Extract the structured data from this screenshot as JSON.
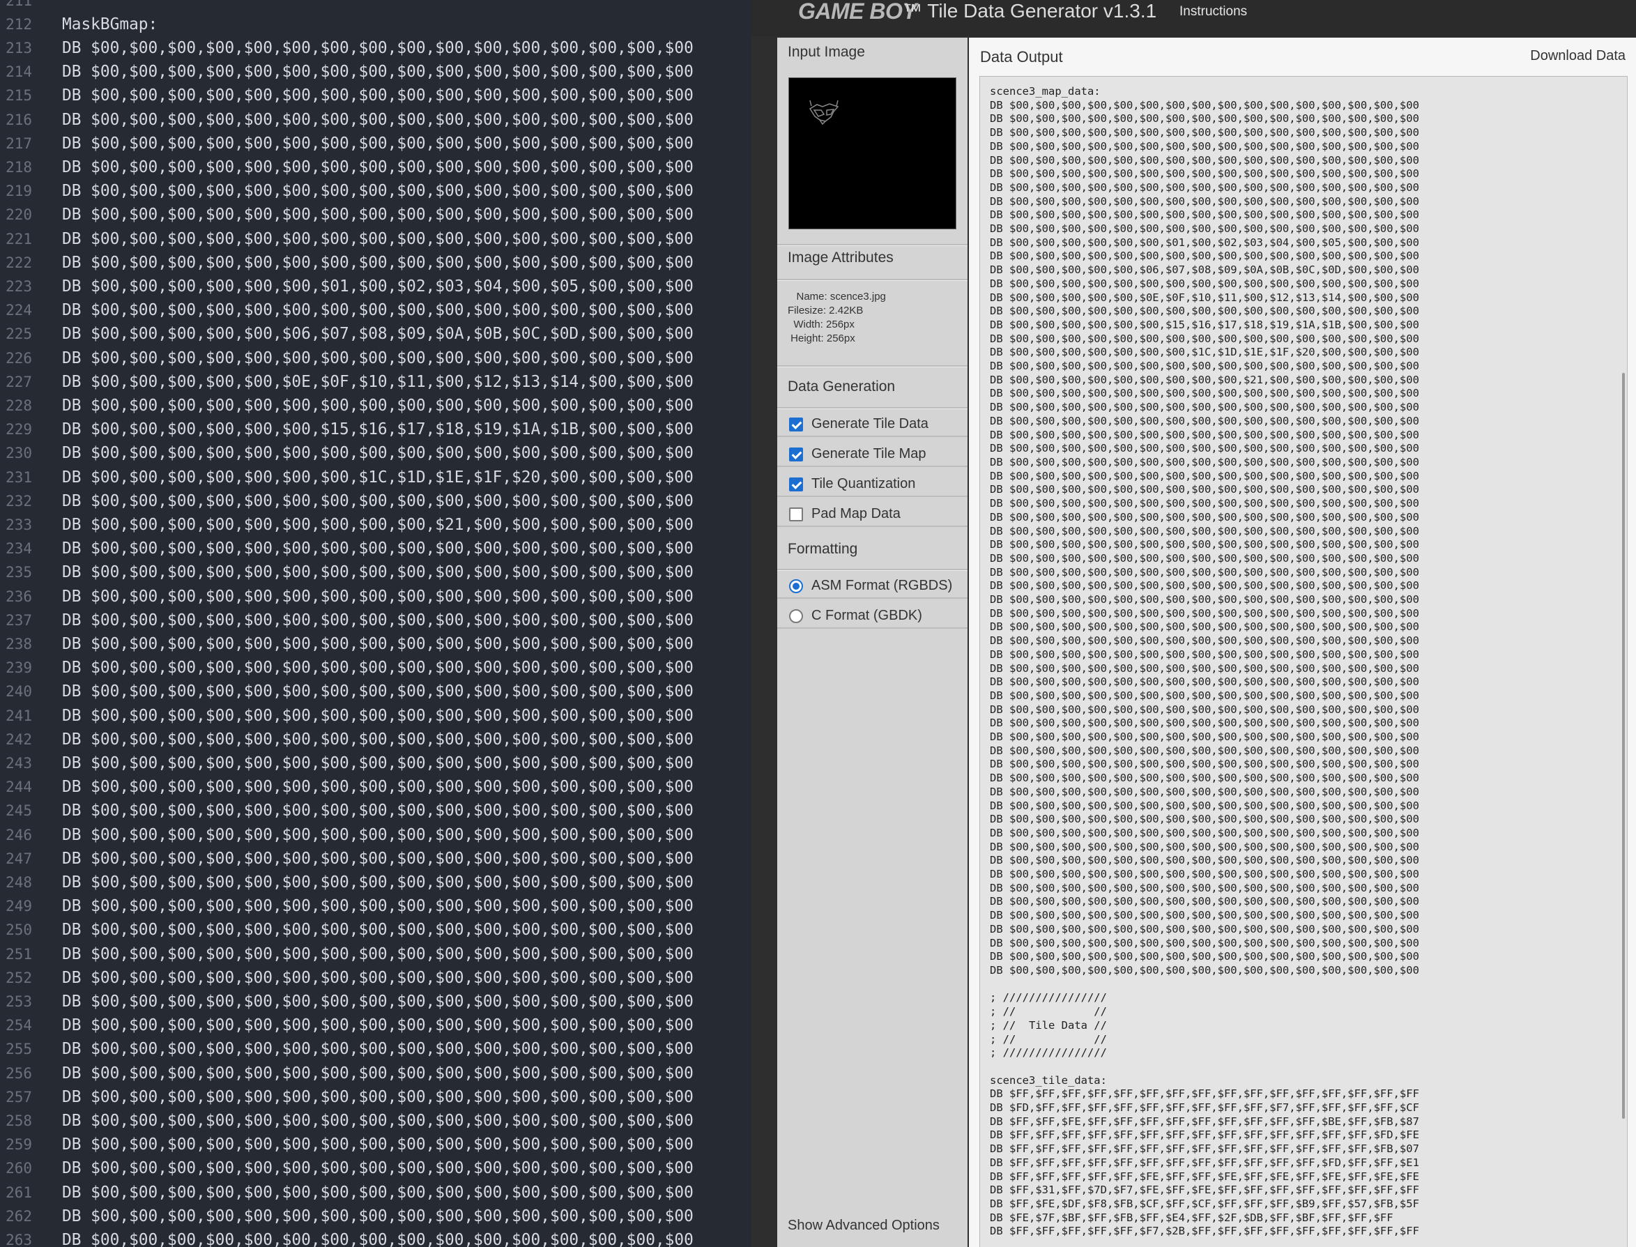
{
  "editor": {
    "lines": [
      {
        "n": "211",
        "t": ""
      },
      {
        "n": "212",
        "t": "MaskBGmap:"
      },
      {
        "n": "213",
        "t": "DB $00,$00,$00,$00,$00,$00,$00,$00,$00,$00,$00,$00,$00,$00,$00,$00"
      },
      {
        "n": "214",
        "t": "DB $00,$00,$00,$00,$00,$00,$00,$00,$00,$00,$00,$00,$00,$00,$00,$00"
      },
      {
        "n": "215",
        "t": "DB $00,$00,$00,$00,$00,$00,$00,$00,$00,$00,$00,$00,$00,$00,$00,$00"
      },
      {
        "n": "216",
        "t": "DB $00,$00,$00,$00,$00,$00,$00,$00,$00,$00,$00,$00,$00,$00,$00,$00"
      },
      {
        "n": "217",
        "t": "DB $00,$00,$00,$00,$00,$00,$00,$00,$00,$00,$00,$00,$00,$00,$00,$00"
      },
      {
        "n": "218",
        "t": "DB $00,$00,$00,$00,$00,$00,$00,$00,$00,$00,$00,$00,$00,$00,$00,$00"
      },
      {
        "n": "219",
        "t": "DB $00,$00,$00,$00,$00,$00,$00,$00,$00,$00,$00,$00,$00,$00,$00,$00"
      },
      {
        "n": "220",
        "t": "DB $00,$00,$00,$00,$00,$00,$00,$00,$00,$00,$00,$00,$00,$00,$00,$00"
      },
      {
        "n": "221",
        "t": "DB $00,$00,$00,$00,$00,$00,$00,$00,$00,$00,$00,$00,$00,$00,$00,$00"
      },
      {
        "n": "222",
        "t": "DB $00,$00,$00,$00,$00,$00,$00,$00,$00,$00,$00,$00,$00,$00,$00,$00"
      },
      {
        "n": "223",
        "t": "DB $00,$00,$00,$00,$00,$00,$01,$00,$02,$03,$04,$00,$05,$00,$00,$00"
      },
      {
        "n": "224",
        "t": "DB $00,$00,$00,$00,$00,$00,$00,$00,$00,$00,$00,$00,$00,$00,$00,$00"
      },
      {
        "n": "225",
        "t": "DB $00,$00,$00,$00,$00,$06,$07,$08,$09,$0A,$0B,$0C,$0D,$00,$00,$00"
      },
      {
        "n": "226",
        "t": "DB $00,$00,$00,$00,$00,$00,$00,$00,$00,$00,$00,$00,$00,$00,$00,$00"
      },
      {
        "n": "227",
        "t": "DB $00,$00,$00,$00,$00,$0E,$0F,$10,$11,$00,$12,$13,$14,$00,$00,$00"
      },
      {
        "n": "228",
        "t": "DB $00,$00,$00,$00,$00,$00,$00,$00,$00,$00,$00,$00,$00,$00,$00,$00"
      },
      {
        "n": "229",
        "t": "DB $00,$00,$00,$00,$00,$00,$15,$16,$17,$18,$19,$1A,$1B,$00,$00,$00"
      },
      {
        "n": "230",
        "t": "DB $00,$00,$00,$00,$00,$00,$00,$00,$00,$00,$00,$00,$00,$00,$00,$00"
      },
      {
        "n": "231",
        "t": "DB $00,$00,$00,$00,$00,$00,$00,$1C,$1D,$1E,$1F,$20,$00,$00,$00,$00"
      },
      {
        "n": "232",
        "t": "DB $00,$00,$00,$00,$00,$00,$00,$00,$00,$00,$00,$00,$00,$00,$00,$00"
      },
      {
        "n": "233",
        "t": "DB $00,$00,$00,$00,$00,$00,$00,$00,$00,$21,$00,$00,$00,$00,$00,$00"
      },
      {
        "n": "234",
        "t": "DB $00,$00,$00,$00,$00,$00,$00,$00,$00,$00,$00,$00,$00,$00,$00,$00"
      },
      {
        "n": "235",
        "t": "DB $00,$00,$00,$00,$00,$00,$00,$00,$00,$00,$00,$00,$00,$00,$00,$00"
      },
      {
        "n": "236",
        "t": "DB $00,$00,$00,$00,$00,$00,$00,$00,$00,$00,$00,$00,$00,$00,$00,$00"
      },
      {
        "n": "237",
        "t": "DB $00,$00,$00,$00,$00,$00,$00,$00,$00,$00,$00,$00,$00,$00,$00,$00"
      },
      {
        "n": "238",
        "t": "DB $00,$00,$00,$00,$00,$00,$00,$00,$00,$00,$00,$00,$00,$00,$00,$00"
      },
      {
        "n": "239",
        "t": "DB $00,$00,$00,$00,$00,$00,$00,$00,$00,$00,$00,$00,$00,$00,$00,$00"
      },
      {
        "n": "240",
        "t": "DB $00,$00,$00,$00,$00,$00,$00,$00,$00,$00,$00,$00,$00,$00,$00,$00"
      },
      {
        "n": "241",
        "t": "DB $00,$00,$00,$00,$00,$00,$00,$00,$00,$00,$00,$00,$00,$00,$00,$00"
      },
      {
        "n": "242",
        "t": "DB $00,$00,$00,$00,$00,$00,$00,$00,$00,$00,$00,$00,$00,$00,$00,$00"
      },
      {
        "n": "243",
        "t": "DB $00,$00,$00,$00,$00,$00,$00,$00,$00,$00,$00,$00,$00,$00,$00,$00"
      },
      {
        "n": "244",
        "t": "DB $00,$00,$00,$00,$00,$00,$00,$00,$00,$00,$00,$00,$00,$00,$00,$00"
      },
      {
        "n": "245",
        "t": "DB $00,$00,$00,$00,$00,$00,$00,$00,$00,$00,$00,$00,$00,$00,$00,$00"
      },
      {
        "n": "246",
        "t": "DB $00,$00,$00,$00,$00,$00,$00,$00,$00,$00,$00,$00,$00,$00,$00,$00"
      },
      {
        "n": "247",
        "t": "DB $00,$00,$00,$00,$00,$00,$00,$00,$00,$00,$00,$00,$00,$00,$00,$00"
      },
      {
        "n": "248",
        "t": "DB $00,$00,$00,$00,$00,$00,$00,$00,$00,$00,$00,$00,$00,$00,$00,$00"
      },
      {
        "n": "249",
        "t": "DB $00,$00,$00,$00,$00,$00,$00,$00,$00,$00,$00,$00,$00,$00,$00,$00"
      },
      {
        "n": "250",
        "t": "DB $00,$00,$00,$00,$00,$00,$00,$00,$00,$00,$00,$00,$00,$00,$00,$00"
      },
      {
        "n": "251",
        "t": "DB $00,$00,$00,$00,$00,$00,$00,$00,$00,$00,$00,$00,$00,$00,$00,$00"
      },
      {
        "n": "252",
        "t": "DB $00,$00,$00,$00,$00,$00,$00,$00,$00,$00,$00,$00,$00,$00,$00,$00"
      },
      {
        "n": "253",
        "t": "DB $00,$00,$00,$00,$00,$00,$00,$00,$00,$00,$00,$00,$00,$00,$00,$00"
      },
      {
        "n": "254",
        "t": "DB $00,$00,$00,$00,$00,$00,$00,$00,$00,$00,$00,$00,$00,$00,$00,$00"
      },
      {
        "n": "255",
        "t": "DB $00,$00,$00,$00,$00,$00,$00,$00,$00,$00,$00,$00,$00,$00,$00,$00"
      },
      {
        "n": "256",
        "t": "DB $00,$00,$00,$00,$00,$00,$00,$00,$00,$00,$00,$00,$00,$00,$00,$00"
      },
      {
        "n": "257",
        "t": "DB $00,$00,$00,$00,$00,$00,$00,$00,$00,$00,$00,$00,$00,$00,$00,$00"
      },
      {
        "n": "258",
        "t": "DB $00,$00,$00,$00,$00,$00,$00,$00,$00,$00,$00,$00,$00,$00,$00,$00"
      },
      {
        "n": "259",
        "t": "DB $00,$00,$00,$00,$00,$00,$00,$00,$00,$00,$00,$00,$00,$00,$00,$00"
      },
      {
        "n": "260",
        "t": "DB $00,$00,$00,$00,$00,$00,$00,$00,$00,$00,$00,$00,$00,$00,$00,$00"
      },
      {
        "n": "261",
        "t": "DB $00,$00,$00,$00,$00,$00,$00,$00,$00,$00,$00,$00,$00,$00,$00,$00"
      },
      {
        "n": "262",
        "t": "DB $00,$00,$00,$00,$00,$00,$00,$00,$00,$00,$00,$00,$00,$00,$00,$00"
      },
      {
        "n": "263",
        "t": "DB $00,$00,$00,$00,$00,$00,$00,$00,$00,$00,$00,$00,$00,$00,$00,$00"
      }
    ]
  },
  "app": {
    "logo": "GAME BOY",
    "title": "™ Tile Data Generator v1.3.1",
    "nav_instructions": "Instructions"
  },
  "sidebar": {
    "input_image_heading": "Input Image",
    "image_attributes_heading": "Image Attributes",
    "attributes": {
      "name": "   Name: scence3.jpg",
      "filesize": "Filesize: 2.42KB",
      "width": "  Width: 256px",
      "height": " Height: 256px"
    },
    "data_generation_heading": "Data Generation",
    "options": [
      {
        "label": "Generate Tile Data",
        "checked": true
      },
      {
        "label": "Generate Tile Map",
        "checked": true
      },
      {
        "label": "Tile Quantization",
        "checked": true
      },
      {
        "label": "Pad Map Data",
        "checked": false
      }
    ],
    "formatting_heading": "Formatting",
    "formats": [
      {
        "label": "ASM Format (RGBDS)",
        "selected": true
      },
      {
        "label": "C Format (GBDK)",
        "selected": false
      }
    ],
    "advanced_link": "Show Advanced Options"
  },
  "output": {
    "heading": "Data Output",
    "download_label": "Download Data",
    "text": "scence3_map_data:\nDB $00,$00,$00,$00,$00,$00,$00,$00,$00,$00,$00,$00,$00,$00,$00,$00\nDB $00,$00,$00,$00,$00,$00,$00,$00,$00,$00,$00,$00,$00,$00,$00,$00\nDB $00,$00,$00,$00,$00,$00,$00,$00,$00,$00,$00,$00,$00,$00,$00,$00\nDB $00,$00,$00,$00,$00,$00,$00,$00,$00,$00,$00,$00,$00,$00,$00,$00\nDB $00,$00,$00,$00,$00,$00,$00,$00,$00,$00,$00,$00,$00,$00,$00,$00\nDB $00,$00,$00,$00,$00,$00,$00,$00,$00,$00,$00,$00,$00,$00,$00,$00\nDB $00,$00,$00,$00,$00,$00,$00,$00,$00,$00,$00,$00,$00,$00,$00,$00\nDB $00,$00,$00,$00,$00,$00,$00,$00,$00,$00,$00,$00,$00,$00,$00,$00\nDB $00,$00,$00,$00,$00,$00,$00,$00,$00,$00,$00,$00,$00,$00,$00,$00\nDB $00,$00,$00,$00,$00,$00,$00,$00,$00,$00,$00,$00,$00,$00,$00,$00\nDB $00,$00,$00,$00,$00,$00,$01,$00,$02,$03,$04,$00,$05,$00,$00,$00\nDB $00,$00,$00,$00,$00,$00,$00,$00,$00,$00,$00,$00,$00,$00,$00,$00\nDB $00,$00,$00,$00,$00,$06,$07,$08,$09,$0A,$0B,$0C,$0D,$00,$00,$00\nDB $00,$00,$00,$00,$00,$00,$00,$00,$00,$00,$00,$00,$00,$00,$00,$00\nDB $00,$00,$00,$00,$00,$0E,$0F,$10,$11,$00,$12,$13,$14,$00,$00,$00\nDB $00,$00,$00,$00,$00,$00,$00,$00,$00,$00,$00,$00,$00,$00,$00,$00\nDB $00,$00,$00,$00,$00,$00,$15,$16,$17,$18,$19,$1A,$1B,$00,$00,$00\nDB $00,$00,$00,$00,$00,$00,$00,$00,$00,$00,$00,$00,$00,$00,$00,$00\nDB $00,$00,$00,$00,$00,$00,$00,$1C,$1D,$1E,$1F,$20,$00,$00,$00,$00\nDB $00,$00,$00,$00,$00,$00,$00,$00,$00,$00,$00,$00,$00,$00,$00,$00\nDB $00,$00,$00,$00,$00,$00,$00,$00,$00,$21,$00,$00,$00,$00,$00,$00\nDB $00,$00,$00,$00,$00,$00,$00,$00,$00,$00,$00,$00,$00,$00,$00,$00\nDB $00,$00,$00,$00,$00,$00,$00,$00,$00,$00,$00,$00,$00,$00,$00,$00\nDB $00,$00,$00,$00,$00,$00,$00,$00,$00,$00,$00,$00,$00,$00,$00,$00\nDB $00,$00,$00,$00,$00,$00,$00,$00,$00,$00,$00,$00,$00,$00,$00,$00\nDB $00,$00,$00,$00,$00,$00,$00,$00,$00,$00,$00,$00,$00,$00,$00,$00\nDB $00,$00,$00,$00,$00,$00,$00,$00,$00,$00,$00,$00,$00,$00,$00,$00\nDB $00,$00,$00,$00,$00,$00,$00,$00,$00,$00,$00,$00,$00,$00,$00,$00\nDB $00,$00,$00,$00,$00,$00,$00,$00,$00,$00,$00,$00,$00,$00,$00,$00\nDB $00,$00,$00,$00,$00,$00,$00,$00,$00,$00,$00,$00,$00,$00,$00,$00\nDB $00,$00,$00,$00,$00,$00,$00,$00,$00,$00,$00,$00,$00,$00,$00,$00\nDB $00,$00,$00,$00,$00,$00,$00,$00,$00,$00,$00,$00,$00,$00,$00,$00\nDB $00,$00,$00,$00,$00,$00,$00,$00,$00,$00,$00,$00,$00,$00,$00,$00\nDB $00,$00,$00,$00,$00,$00,$00,$00,$00,$00,$00,$00,$00,$00,$00,$00\nDB $00,$00,$00,$00,$00,$00,$00,$00,$00,$00,$00,$00,$00,$00,$00,$00\nDB $00,$00,$00,$00,$00,$00,$00,$00,$00,$00,$00,$00,$00,$00,$00,$00\nDB $00,$00,$00,$00,$00,$00,$00,$00,$00,$00,$00,$00,$00,$00,$00,$00\nDB $00,$00,$00,$00,$00,$00,$00,$00,$00,$00,$00,$00,$00,$00,$00,$00\nDB $00,$00,$00,$00,$00,$00,$00,$00,$00,$00,$00,$00,$00,$00,$00,$00\nDB $00,$00,$00,$00,$00,$00,$00,$00,$00,$00,$00,$00,$00,$00,$00,$00\nDB $00,$00,$00,$00,$00,$00,$00,$00,$00,$00,$00,$00,$00,$00,$00,$00\nDB $00,$00,$00,$00,$00,$00,$00,$00,$00,$00,$00,$00,$00,$00,$00,$00\nDB $00,$00,$00,$00,$00,$00,$00,$00,$00,$00,$00,$00,$00,$00,$00,$00\nDB $00,$00,$00,$00,$00,$00,$00,$00,$00,$00,$00,$00,$00,$00,$00,$00\nDB $00,$00,$00,$00,$00,$00,$00,$00,$00,$00,$00,$00,$00,$00,$00,$00\nDB $00,$00,$00,$00,$00,$00,$00,$00,$00,$00,$00,$00,$00,$00,$00,$00\nDB $00,$00,$00,$00,$00,$00,$00,$00,$00,$00,$00,$00,$00,$00,$00,$00\nDB $00,$00,$00,$00,$00,$00,$00,$00,$00,$00,$00,$00,$00,$00,$00,$00\nDB $00,$00,$00,$00,$00,$00,$00,$00,$00,$00,$00,$00,$00,$00,$00,$00\nDB $00,$00,$00,$00,$00,$00,$00,$00,$00,$00,$00,$00,$00,$00,$00,$00\nDB $00,$00,$00,$00,$00,$00,$00,$00,$00,$00,$00,$00,$00,$00,$00,$00\nDB $00,$00,$00,$00,$00,$00,$00,$00,$00,$00,$00,$00,$00,$00,$00,$00\nDB $00,$00,$00,$00,$00,$00,$00,$00,$00,$00,$00,$00,$00,$00,$00,$00\nDB $00,$00,$00,$00,$00,$00,$00,$00,$00,$00,$00,$00,$00,$00,$00,$00\nDB $00,$00,$00,$00,$00,$00,$00,$00,$00,$00,$00,$00,$00,$00,$00,$00\nDB $00,$00,$00,$00,$00,$00,$00,$00,$00,$00,$00,$00,$00,$00,$00,$00\nDB $00,$00,$00,$00,$00,$00,$00,$00,$00,$00,$00,$00,$00,$00,$00,$00\nDB $00,$00,$00,$00,$00,$00,$00,$00,$00,$00,$00,$00,$00,$00,$00,$00\nDB $00,$00,$00,$00,$00,$00,$00,$00,$00,$00,$00,$00,$00,$00,$00,$00\nDB $00,$00,$00,$00,$00,$00,$00,$00,$00,$00,$00,$00,$00,$00,$00,$00\nDB $00,$00,$00,$00,$00,$00,$00,$00,$00,$00,$00,$00,$00,$00,$00,$00\nDB $00,$00,$00,$00,$00,$00,$00,$00,$00,$00,$00,$00,$00,$00,$00,$00\nDB $00,$00,$00,$00,$00,$00,$00,$00,$00,$00,$00,$00,$00,$00,$00,$00\nDB $00,$00,$00,$00,$00,$00,$00,$00,$00,$00,$00,$00,$00,$00,$00,$00\n\n; ////////////////\n; //            //\n; //  Tile Data //\n; //            //\n; ////////////////\n\nscence3_tile_data:\nDB $FF,$FF,$FF,$FF,$FF,$FF,$FF,$FF,$FF,$FF,$FF,$FF,$FF,$FF,$FF,$FF\nDB $FD,$FF,$FF,$FF,$FF,$FF,$FF,$FF,$FF,$FF,$F7,$FF,$FF,$FF,$FF,$CF\nDB $FF,$FF,$FE,$FF,$FF,$FF,$FF,$FF,$FF,$FF,$FF,$FF,$BE,$FF,$FB,$87\nDB $FF,$FF,$FF,$FF,$FF,$FF,$FF,$FF,$FF,$FF,$FF,$FF,$FF,$FF,$FD,$FE\nDB $FF,$FF,$FF,$FF,$FF,$FF,$FF,$FF,$FF,$FF,$FF,$FF,$FF,$FF,$FB,$07\nDB $FF,$FF,$FF,$FF,$FF,$FF,$FF,$FF,$FF,$FF,$FF,$FF,$FD,$FF,$FF,$E1\nDB $FF,$FF,$FF,$FF,$FF,$FE,$FF,$FF,$FE,$FF,$FE,$FF,$FE,$FF,$FE,$FE\nDB $FF,$31,$FF,$7D,$F7,$FE,$FF,$FE,$FF,$FF,$FF,$FF,$FF,$FF,$FF,$FF\nDB $FF,$FE,$DF,$F8,$FB,$CF,$FF,$CF,$FF,$FF,$FF,$B9,$FF,$57,$FB,$5F\nDB $FE,$7F,$BF,$FF,$FB,$FF,$E4,$FF,$2F,$DB,$FF,$BF,$FF,$FF,$FF\nDB $FF,$FF,$FF,$FF,$FF,$F7,$2B,$FF,$FF,$FF,$FF,$FF,$FF,$FF,$FF,$FF"
  },
  "colors": {
    "editor_bg": "#262b33",
    "app_bg": "#2e2e2e",
    "sidebar_bg": "#d4d4d4",
    "output_box_bg": "#e4e4e4",
    "accent": "#1c6fd0"
  }
}
